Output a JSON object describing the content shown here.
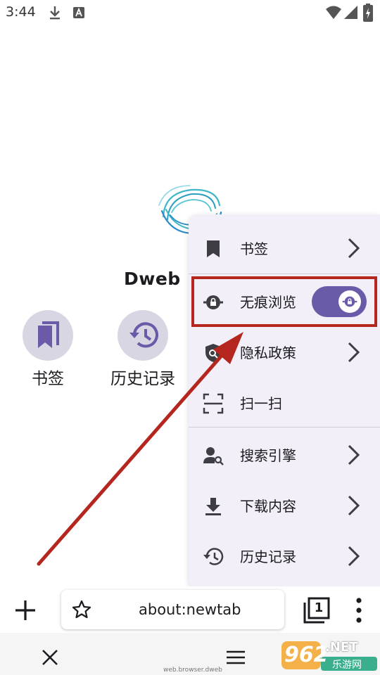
{
  "status_bar": {
    "time": "3:44",
    "icons": [
      "download-icon",
      "a-notification-icon",
      "wifi-icon",
      "signal-icon",
      "battery-charging-icon"
    ]
  },
  "home": {
    "app_name": "Dweb B",
    "shortcuts": [
      {
        "label": "书签",
        "icon": "bookmarks-icon"
      },
      {
        "label": "历史记录",
        "icon": "history-icon"
      }
    ]
  },
  "menu": {
    "items": [
      {
        "label": "书签",
        "icon": "bookmark-icon",
        "has_chevron": true
      },
      {
        "label": "无痕浏览",
        "icon": "incognito-icon",
        "toggle_on": true
      },
      {
        "label": "隐私政策",
        "icon": "privacy-shield-icon",
        "has_chevron": true
      },
      {
        "label": "扫一扫",
        "icon": "scan-icon",
        "has_chevron": false
      },
      {
        "label": "搜索引擎",
        "icon": "search-engine-icon",
        "has_chevron": true
      },
      {
        "label": "下载内容",
        "icon": "download-icon",
        "has_chevron": true
      },
      {
        "label": "历史记录",
        "icon": "history-icon",
        "has_chevron": true
      }
    ]
  },
  "address_bar": {
    "url": "about:newtab",
    "tab_count": "1"
  },
  "nav_bar": {
    "caption": "web.browser.dweb"
  },
  "watermark": {
    "number": "962",
    "suffix": ".NET",
    "subtitle": "乐游网"
  },
  "colors": {
    "accent": "#6a5aa8",
    "highlight": "#b5261e",
    "menu_bg": "#f2eff8",
    "shortcut_bg": "#d9d6e3"
  }
}
